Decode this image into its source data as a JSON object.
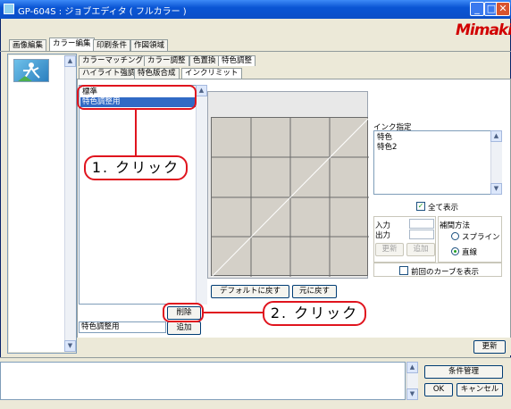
{
  "window": {
    "title": "GP-604S : ジョブエディタ ( フルカラー )",
    "brand": "Mimaki",
    "controls": {
      "minimize": "_",
      "maximize": "□",
      "close": "✕"
    }
  },
  "main_tabs": [
    "画像編集",
    "カラー編集",
    "印刷条件",
    "作図領域"
  ],
  "sub_tabs_row1": [
    "カラーマッチング",
    "カラー調整",
    "色置換",
    "特色調整"
  ],
  "sub_tabs_row2": [
    "ハイライト強調",
    "特色版合成",
    "インクリミット"
  ],
  "preset_list": {
    "items": [
      "標準",
      "特色調整用"
    ],
    "selected_index": 1
  },
  "name_field": {
    "value": "特色調整用"
  },
  "buttons": {
    "delete": "削除",
    "add": "追加",
    "default": "デフォルトに戻す",
    "undo": "元に戻す",
    "update": "更新",
    "point_update": "更新",
    "point_add": "追加",
    "condition_manage": "条件管理",
    "ok": "OK",
    "cancel": "キャンセル"
  },
  "ink_panel": {
    "label": "インク指定",
    "items": [
      "特色",
      "特色2"
    ],
    "show_all_label": "全て表示",
    "show_all_checked": true
  },
  "io": {
    "input_label": "入力",
    "output_label": "出力"
  },
  "interp": {
    "label": "補間方法",
    "options": [
      "スプライン",
      "直線"
    ],
    "selected": "直線"
  },
  "prev_curve": {
    "label": "前回のカーブを表示",
    "checked": false
  },
  "callouts": {
    "step1": "1. クリック",
    "step2": "2. クリック",
    "color": "#e0141e"
  },
  "icons": {
    "scroll_up": "▲",
    "scroll_down": "▼",
    "check": "✓"
  }
}
